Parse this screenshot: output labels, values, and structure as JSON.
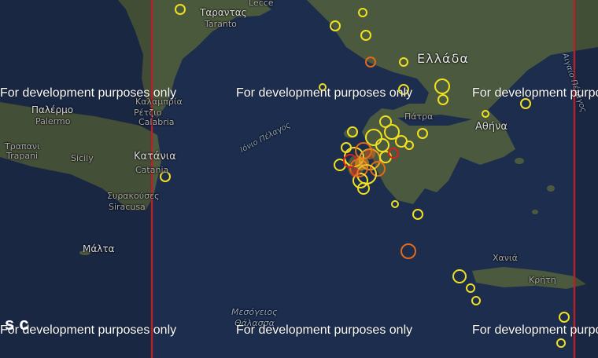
{
  "watermark": "For development purposes only",
  "labels": {
    "taranto_gr": "Ταραντας",
    "taranto": "Taranto",
    "lecce": "Lecce",
    "greece": "Ελλάδα",
    "palermo_gr": "Παλέρμο",
    "palermo": "Palermo",
    "trapani_gr": "Τραπανι",
    "trapani": "Trapani",
    "sicily": "Sicily",
    "catania_gr": "Κατάνια",
    "catania": "Catania",
    "kalamata_gr": "Καλαμπρία",
    "calabria": "Calabria",
    "reggio_gr": "Ρέτζιο",
    "patra": "Πάτρα",
    "athens": "Αθήνα",
    "syracuse_gr": "Συρακούσες",
    "siracusa": "Siracusa",
    "malta": "Μάλτα",
    "ionian_sea": "Ιόνιο Πέλαγος",
    "med_sea_1": "Μεσόγειος",
    "med_sea_2": "Θάλασσα",
    "chania": "Χανιά",
    "crete": "Κρήτη",
    "aigaio": "Αιγαίο Πέλαγος",
    "left_fragment": "s c"
  },
  "colors": {
    "sea": "#1c2c4c",
    "land": "#4b5a3e",
    "marker_yellow": "#f0e020",
    "marker_orange": "#e06a1a",
    "marker_red": "#d82020",
    "boundary_red": "#b3232a"
  }
}
